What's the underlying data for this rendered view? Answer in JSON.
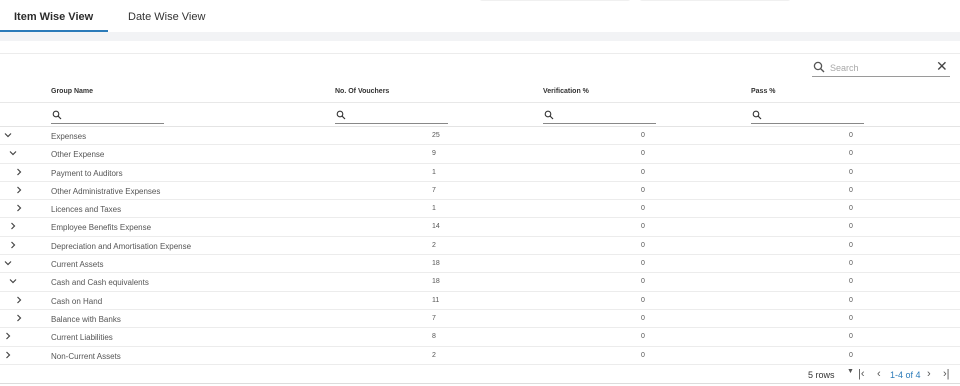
{
  "tabs": [
    {
      "label": "Item Wise View",
      "active": true
    },
    {
      "label": "Date Wise View",
      "active": false
    }
  ],
  "search": {
    "placeholder": "Search",
    "value": ""
  },
  "columns": [
    "Group Name",
    "No. Of Vouchers",
    "Verification %",
    "Pass %"
  ],
  "rows": [
    {
      "name": "Expenses",
      "vouchers": "25",
      "verification": "0",
      "pass": "0",
      "expanded": true,
      "level": 0
    },
    {
      "name": "Other Expense",
      "vouchers": "9",
      "verification": "0",
      "pass": "0",
      "expanded": true,
      "level": 1
    },
    {
      "name": "Payment to Auditors",
      "vouchers": "1",
      "verification": "0",
      "pass": "0",
      "expanded": false,
      "level": 2
    },
    {
      "name": "Other Administrative Expenses",
      "vouchers": "7",
      "verification": "0",
      "pass": "0",
      "expanded": false,
      "level": 2
    },
    {
      "name": "Licences and Taxes",
      "vouchers": "1",
      "verification": "0",
      "pass": "0",
      "expanded": false,
      "level": 2
    },
    {
      "name": "Employee Benefits Expense",
      "vouchers": "14",
      "verification": "0",
      "pass": "0",
      "expanded": false,
      "level": 1
    },
    {
      "name": "Depreciation and Amortisation Expense",
      "vouchers": "2",
      "verification": "0",
      "pass": "0",
      "expanded": false,
      "level": 1
    },
    {
      "name": "Current Assets",
      "vouchers": "18",
      "verification": "0",
      "pass": "0",
      "expanded": true,
      "level": 0
    },
    {
      "name": "Cash and Cash equivalents",
      "vouchers": "18",
      "verification": "0",
      "pass": "0",
      "expanded": true,
      "level": 1
    },
    {
      "name": "Cash on Hand",
      "vouchers": "11",
      "verification": "0",
      "pass": "0",
      "expanded": false,
      "level": 2
    },
    {
      "name": "Balance with Banks",
      "vouchers": "7",
      "verification": "0",
      "pass": "0",
      "expanded": false,
      "level": 2
    },
    {
      "name": "Current Liabilities",
      "vouchers": "8",
      "verification": "0",
      "pass": "0",
      "expanded": false,
      "level": 0
    },
    {
      "name": "Non-Current Assets",
      "vouchers": "2",
      "verification": "0",
      "pass": "0",
      "expanded": false,
      "level": 0
    }
  ],
  "footer": {
    "rows_per_page": "5 rows",
    "range": "1-4 of 4"
  },
  "colors": {
    "accent": "#2b7bb9",
    "text": "#555555"
  }
}
